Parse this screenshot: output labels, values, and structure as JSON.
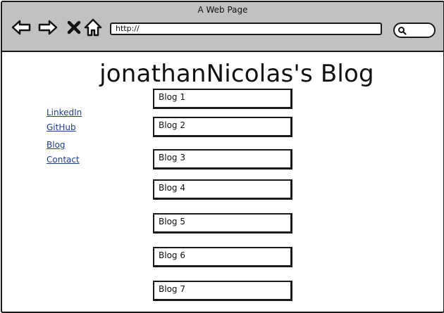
{
  "browser": {
    "window_title": "A Web Page",
    "url": "http://",
    "icons": [
      "back-arrow-icon",
      "forward-arrow-icon",
      "close-icon",
      "home-icon",
      "search-icon"
    ]
  },
  "page": {
    "title": "jonathanNicolas's Blog",
    "nav_links": [
      {
        "label": "LinkedIn"
      },
      {
        "label": "GitHub"
      },
      {
        "label": "Blog"
      },
      {
        "label": "Contact"
      }
    ],
    "blog_items": [
      {
        "label": "Blog 1"
      },
      {
        "label": "Blog 2"
      },
      {
        "label": "Blog 3"
      },
      {
        "label": "Blog 4"
      },
      {
        "label": "Blog 5"
      },
      {
        "label": "Blog 6"
      },
      {
        "label": "Blog 7"
      }
    ]
  },
  "colors": {
    "chrome_bg": "#c1c1c1",
    "link": "#1f3f8f",
    "border": "#1a1a1a"
  }
}
